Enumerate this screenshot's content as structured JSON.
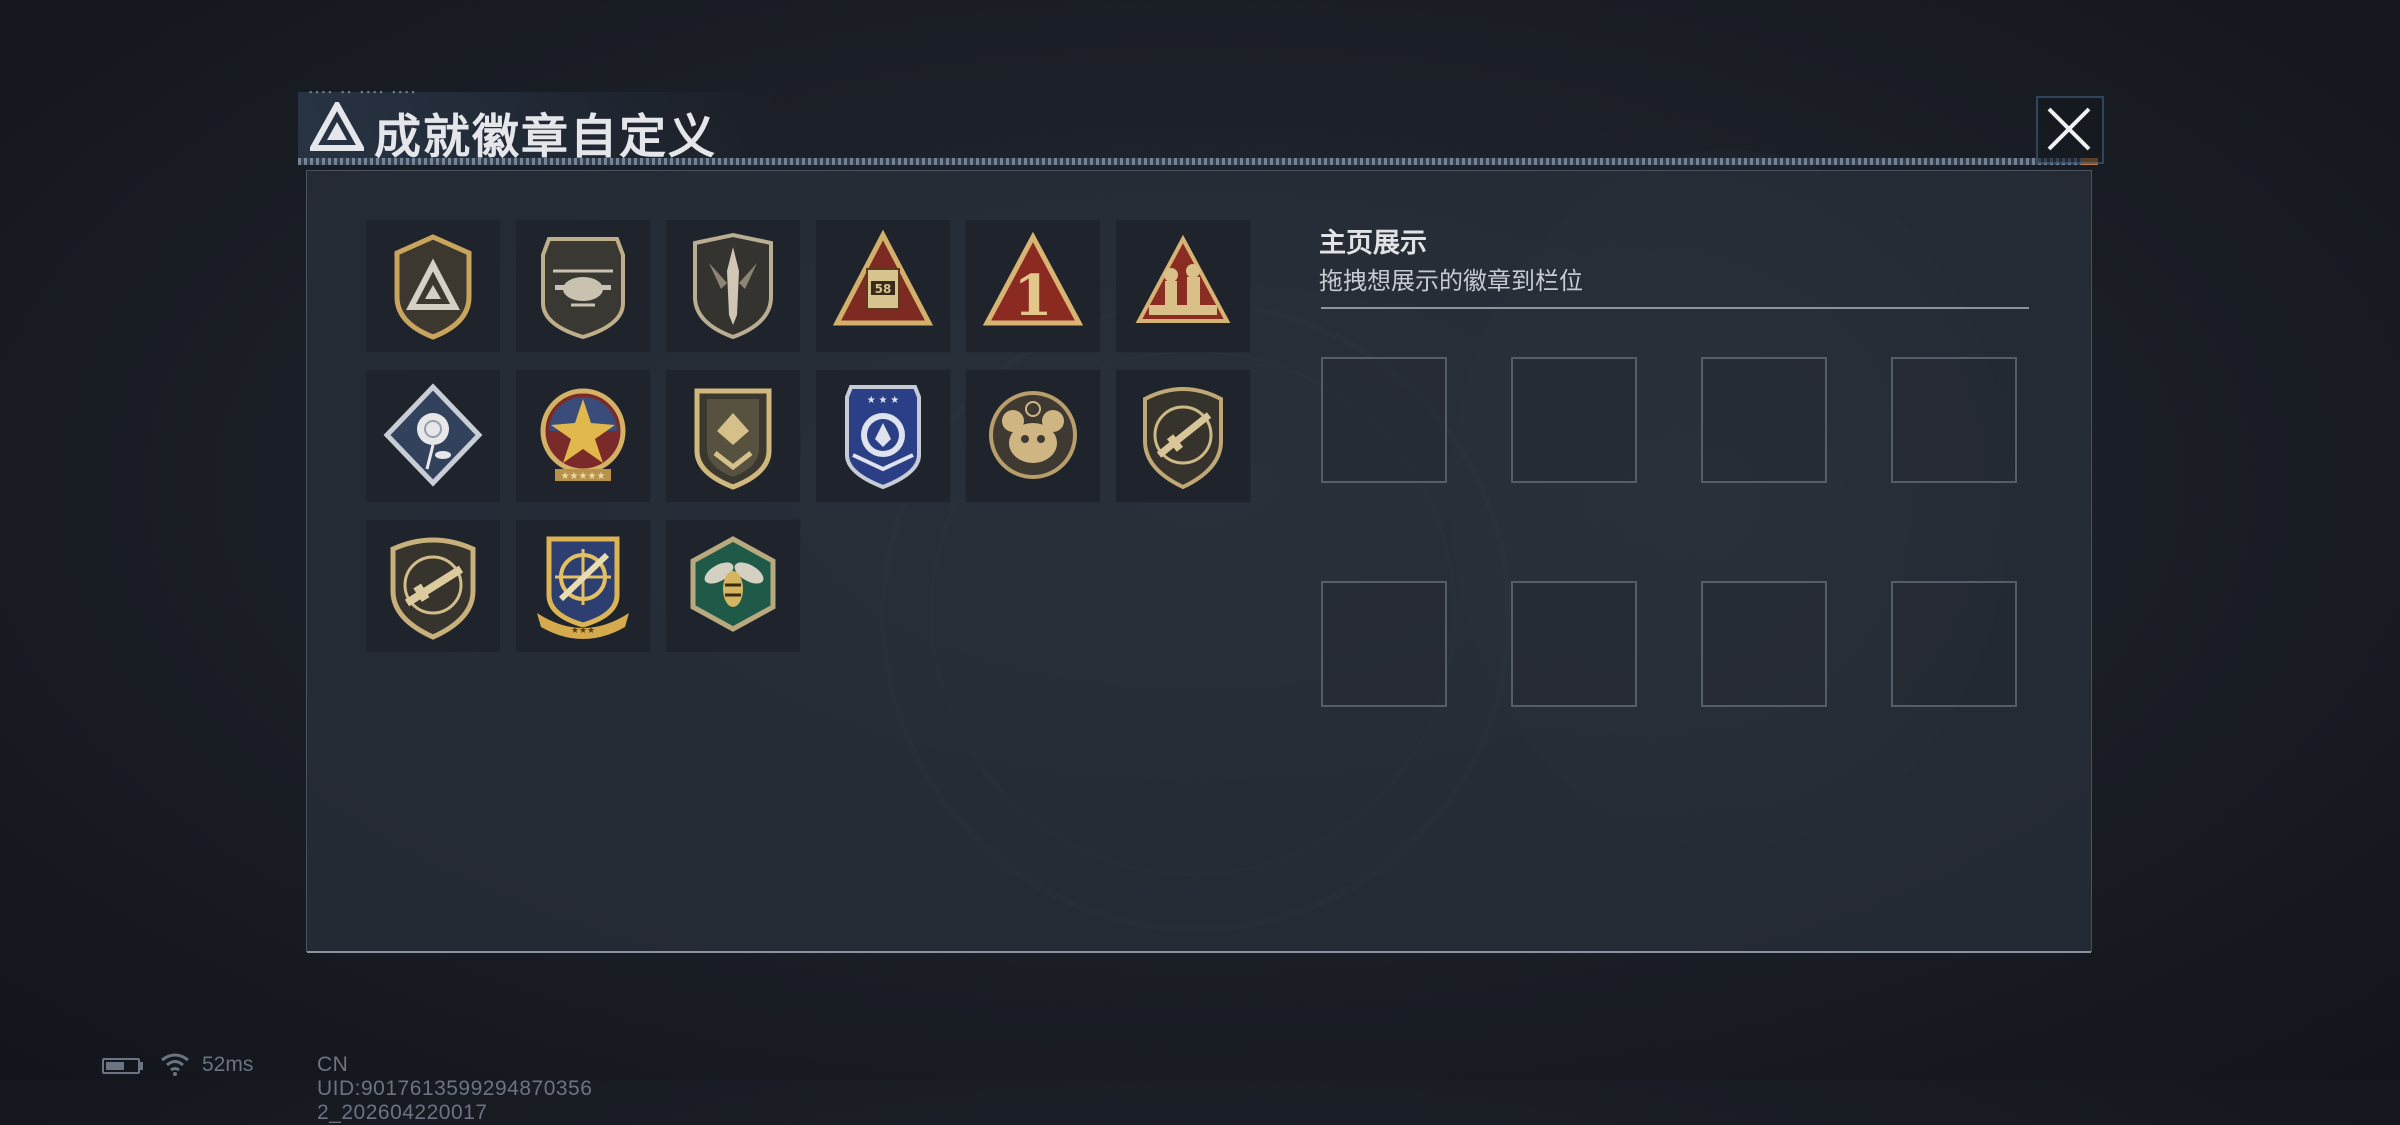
{
  "title": "成就徽章自定义",
  "showcase": {
    "title": "主页展示",
    "subtitle": "拖拽想展示的徽章到栏位",
    "slot_count": 8
  },
  "badges": [
    {
      "name": "triangle-shield-badge"
    },
    {
      "name": "helicopter-shield-badge"
    },
    {
      "name": "dagger-shield-badge"
    },
    {
      "name": "mech-triangle-badge",
      "text": "58"
    },
    {
      "name": "number-one-triangle-badge",
      "text": "1"
    },
    {
      "name": "soldiers-triangle-badge"
    },
    {
      "name": "rose-diamond-badge"
    },
    {
      "name": "star-compass-badge"
    },
    {
      "name": "chevron-shield-badge"
    },
    {
      "name": "blue-eagle-badge"
    },
    {
      "name": "bear-skull-badge"
    },
    {
      "name": "rifle-crest-badge"
    },
    {
      "name": "smg-crest-badge"
    },
    {
      "name": "crosshair-ribbon-badge"
    },
    {
      "name": "hornet-hexagon-badge"
    }
  ],
  "status": {
    "ping": "52ms",
    "uid": "CN UID:9017613599294870356​2_202604220017"
  },
  "colors": {
    "accent_orange": "#c8772e",
    "gold": "#c9a45c",
    "panel": "#2a303a"
  }
}
